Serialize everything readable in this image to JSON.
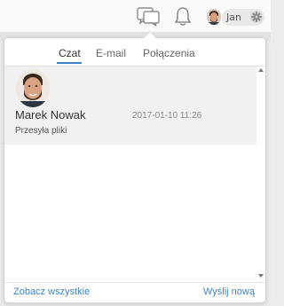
{
  "topbar": {
    "user_name": "Jan",
    "icons": [
      "chat-icon",
      "bell-icon",
      "gear-icon"
    ]
  },
  "popover": {
    "tabs": [
      {
        "label": "Czat",
        "active": true
      },
      {
        "label": "E-mail",
        "active": false
      },
      {
        "label": "Połączenia",
        "active": false
      }
    ],
    "messages": [
      {
        "sender": "Marek Nowak",
        "timestamp": "2017-01-10 11:26",
        "preview": "Przesyła pliki"
      }
    ],
    "footer": {
      "see_all": "Zobacz wszystkie",
      "send_new": "Wyślij nową"
    }
  },
  "colors": {
    "accent": "#3a85c9",
    "selected_row": "#f1f1f1",
    "background": "#ececec"
  }
}
